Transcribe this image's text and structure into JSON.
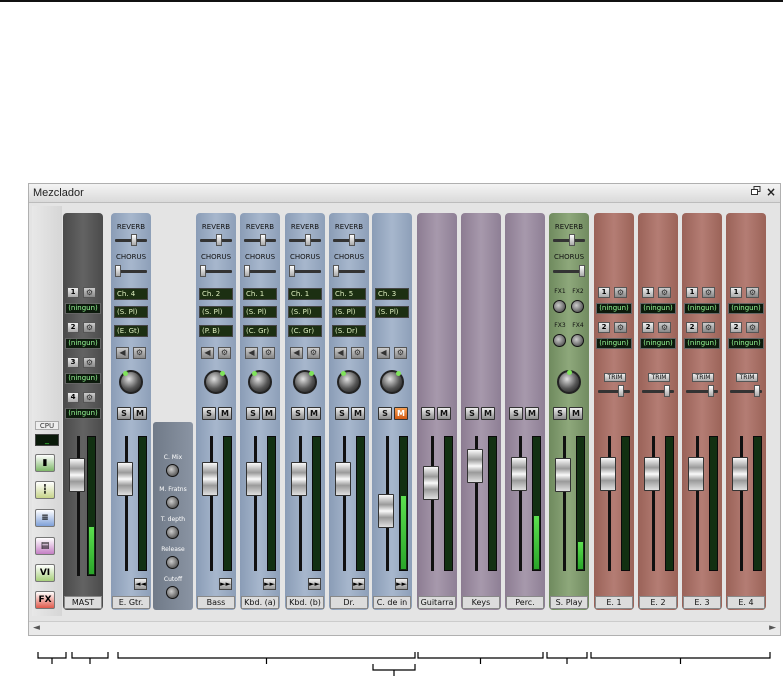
{
  "window": {
    "title": "Mezclador",
    "restore_icon": "restore-icon",
    "close_icon": "×"
  },
  "cpu": {
    "label": "CPU",
    "value": "_"
  },
  "left_buttons": [
    {
      "name": "meters-view-button",
      "label": "▮",
      "color": "#7fb86a",
      "icon": "level-bars-icon"
    },
    {
      "name": "narrow-view-button",
      "label": "┇",
      "color": "#c7d48a",
      "icon": "narrow-icon"
    },
    {
      "name": "list-view-button",
      "label": "≡",
      "color": "#7fa0d8",
      "icon": "list-icon"
    },
    {
      "name": "track-view-button",
      "label": "▤",
      "color": "#c47fc4",
      "icon": "tracks-icon"
    },
    {
      "name": "vi-button",
      "label": "VI",
      "color": "#a8d07c",
      "icon": "vi-icon"
    },
    {
      "name": "fx-button",
      "label": "FX",
      "color": "#e05a4c",
      "icon": "fx-icon"
    }
  ],
  "master": {
    "label": "MAST",
    "sends": [
      {
        "num": "1",
        "dest": "(ningun)"
      },
      {
        "num": "2",
        "dest": "(ningun)"
      },
      {
        "num": "3",
        "dest": "(ningun)"
      },
      {
        "num": "4",
        "dest": "(ningun)"
      }
    ]
  },
  "fx_panel": {
    "params": [
      "C. Mix",
      "M. Fratns",
      "T. depth",
      "Release",
      "Cutoff"
    ]
  },
  "effect_labels": {
    "reverb": "REVERB",
    "chorus": "CHORUS",
    "trim": "TRIM",
    "solo": "S",
    "mute": "M"
  },
  "blue_channels": [
    {
      "label": "E. Gtr.",
      "channel": "Ch. 4",
      "port": "(S. Pl)",
      "preset": "(E. Gt)",
      "muted": false
    },
    {
      "label": "Bass",
      "channel": "Ch. 2",
      "port": "(S. Pl)",
      "preset": "(P. B)",
      "muted": false
    },
    {
      "label": "Kbd. (a)",
      "channel": "Ch. 1",
      "port": "(S. Pl)",
      "preset": "(C. Gr)",
      "muted": false
    },
    {
      "label": "Kbd. (b)",
      "channel": "Ch. 1",
      "port": "(S. Pl)",
      "preset": "(C. Gr)",
      "muted": false
    },
    {
      "label": "Dr.",
      "channel": "Ch. 5",
      "port": "(S. Pl)",
      "preset": "(S. Dr)",
      "muted": false
    },
    {
      "label": "C. de in",
      "channel": "Ch. 3",
      "port": "(S. Pl)",
      "preset": "",
      "muted": true
    }
  ],
  "purple_channels": [
    {
      "label": "Guitarra"
    },
    {
      "label": "Keys"
    },
    {
      "label": "Perc."
    }
  ],
  "green_channel": {
    "label": "S. Play",
    "fx": [
      "FX1",
      "FX2",
      "FX3",
      "FX4"
    ]
  },
  "red_channels": [
    {
      "label": "E. 1",
      "sends": [
        {
          "num": "1",
          "dest": "(ningun)"
        },
        {
          "num": "2",
          "dest": "(ningun)"
        }
      ]
    },
    {
      "label": "E. 2",
      "sends": [
        {
          "num": "1",
          "dest": "(ningun)"
        },
        {
          "num": "2",
          "dest": "(ningun)"
        }
      ]
    },
    {
      "label": "E. 3",
      "sends": [
        {
          "num": "1",
          "dest": "(ningun)"
        },
        {
          "num": "2",
          "dest": "(ningun)"
        }
      ]
    },
    {
      "label": "E. 4",
      "sends": [
        {
          "num": "1",
          "dest": "(ningun)"
        },
        {
          "num": "2",
          "dest": "(ningun)"
        }
      ]
    }
  ],
  "scroll": {
    "left": "◄",
    "right": "►"
  }
}
